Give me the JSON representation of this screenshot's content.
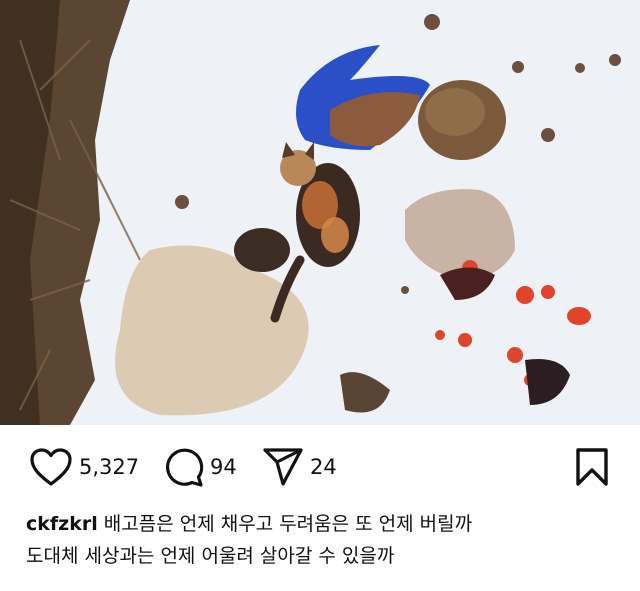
{
  "post": {
    "image_alt_icon": "photo-icon",
    "likes": "5,327",
    "comments": "94",
    "shares": "24",
    "username": "ckfzkrl",
    "caption_line1": "배고픔은 언제 채우고 두려움은 또 언제 버릴까",
    "caption_line2": "도대체 세상과는 언제 어울려 살아갈 수 있을까"
  },
  "icons": {
    "like": "heart-icon",
    "comment": "comment-bubble-icon",
    "share": "paper-plane-icon",
    "save": "bookmark-icon"
  }
}
